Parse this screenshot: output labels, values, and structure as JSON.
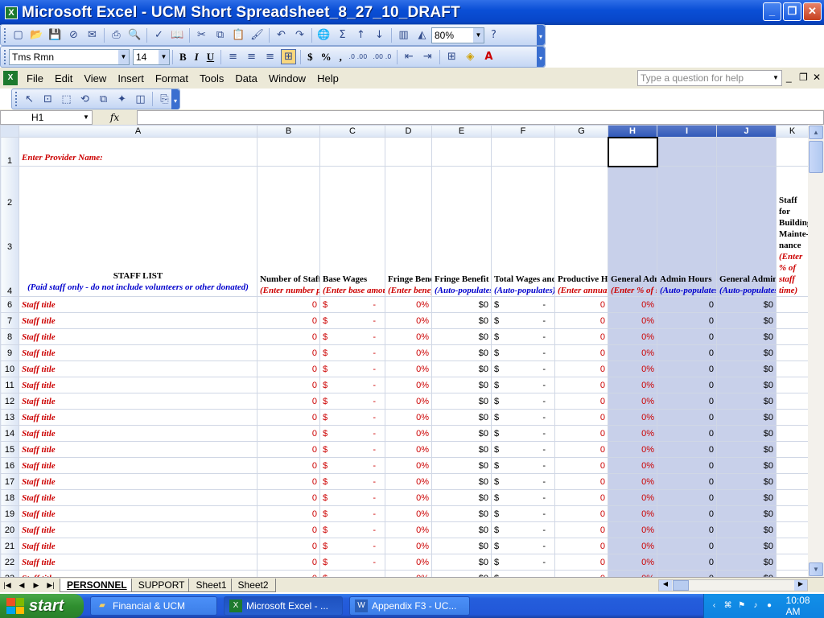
{
  "window": {
    "title": "Microsoft Excel - UCM Short Spreadsheet_8_27_10_DRAFT"
  },
  "toolbar": {
    "font_name": "Tms Rmn",
    "font_size": "14",
    "zoom": "80%",
    "bold": "B",
    "italic": "I",
    "underline": "U",
    "currency": "$",
    "percent": "%",
    "comma": ",",
    "inc_decimal": ".0 .00",
    "dec_decimal": ".00 .0"
  },
  "menu": {
    "items": [
      "File",
      "Edit",
      "View",
      "Insert",
      "Format",
      "Tools",
      "Data",
      "Window",
      "Help"
    ],
    "help_placeholder": "Type a question for help"
  },
  "formula_bar": {
    "name_box": "H1",
    "fx": "fx",
    "value": ""
  },
  "columns": [
    "A",
    "B",
    "C",
    "D",
    "E",
    "F",
    "G",
    "H",
    "I",
    "J",
    "K"
  ],
  "sheet": {
    "row1": {
      "a": "Enter Provider Name:"
    },
    "header": {
      "a_title": "STAFF LIST",
      "a_note": "(Paid staff only - do not include volunteers or other donated)",
      "b_title": "Number of Staff Positions",
      "b_note": "(Enter number per staff title)",
      "c_title": "Base Wages",
      "c_note": "(Enter base amount with no benefits included)",
      "d_title": "Fringe Benefit Rate",
      "d_note": "(Enter benefit costs by % only)",
      "e_title": "Fringe Benefit Dollars",
      "e_note": "(Auto-populates)",
      "f_title": "Total Wages and Benefits",
      "f_note": "(Auto-populates)",
      "g_title": "Productive Hours",
      "g_note": "(Enter annual productive hours)",
      "h_title": "General Admin",
      "h_note": "(Enter % of staff time in admin)",
      "i_title": "Admin Hours",
      "i_note": "(Auto-populates)",
      "j_title": "General Admin Costs",
      "j_note": "(Auto-populates)",
      "k_title": "Staff for Building Mainte-nance",
      "k_note": "(Enter % of staff time)"
    },
    "row_labels": [
      "1",
      "2",
      "3",
      "4"
    ],
    "rows": [
      {
        "n": "6",
        "title": "Staff title",
        "b": "0",
        "c_sym": "$",
        "c": "-",
        "d": "0%",
        "e": "$0",
        "f_sym": "$",
        "f": "-",
        "g": "0",
        "h": "0%",
        "i": "0",
        "j": "$0"
      },
      {
        "n": "7",
        "title": "Staff title",
        "b": "0",
        "c_sym": "$",
        "c": "-",
        "d": "0%",
        "e": "$0",
        "f_sym": "$",
        "f": "-",
        "g": "0",
        "h": "0%",
        "i": "0",
        "j": "$0"
      },
      {
        "n": "8",
        "title": "Staff title",
        "b": "0",
        "c_sym": "$",
        "c": "-",
        "d": "0%",
        "e": "$0",
        "f_sym": "$",
        "f": "-",
        "g": "0",
        "h": "0%",
        "i": "0",
        "j": "$0"
      },
      {
        "n": "9",
        "title": "Staff title",
        "b": "0",
        "c_sym": "$",
        "c": "-",
        "d": "0%",
        "e": "$0",
        "f_sym": "$",
        "f": "-",
        "g": "0",
        "h": "0%",
        "i": "0",
        "j": "$0"
      },
      {
        "n": "10",
        "title": "Staff title",
        "b": "0",
        "c_sym": "$",
        "c": "-",
        "d": "0%",
        "e": "$0",
        "f_sym": "$",
        "f": "-",
        "g": "0",
        "h": "0%",
        "i": "0",
        "j": "$0"
      },
      {
        "n": "11",
        "title": "Staff title",
        "b": "0",
        "c_sym": "$",
        "c": "-",
        "d": "0%",
        "e": "$0",
        "f_sym": "$",
        "f": "-",
        "g": "0",
        "h": "0%",
        "i": "0",
        "j": "$0"
      },
      {
        "n": "12",
        "title": "Staff title",
        "b": "0",
        "c_sym": "$",
        "c": "-",
        "d": "0%",
        "e": "$0",
        "f_sym": "$",
        "f": "-",
        "g": "0",
        "h": "0%",
        "i": "0",
        "j": "$0"
      },
      {
        "n": "13",
        "title": "Staff title",
        "b": "0",
        "c_sym": "$",
        "c": "-",
        "d": "0%",
        "e": "$0",
        "f_sym": "$",
        "f": "-",
        "g": "0",
        "h": "0%",
        "i": "0",
        "j": "$0"
      },
      {
        "n": "14",
        "title": "Staff title",
        "b": "0",
        "c_sym": "$",
        "c": "-",
        "d": "0%",
        "e": "$0",
        "f_sym": "$",
        "f": "-",
        "g": "0",
        "h": "0%",
        "i": "0",
        "j": "$0"
      },
      {
        "n": "15",
        "title": "Staff title",
        "b": "0",
        "c_sym": "$",
        "c": "-",
        "d": "0%",
        "e": "$0",
        "f_sym": "$",
        "f": "-",
        "g": "0",
        "h": "0%",
        "i": "0",
        "j": "$0"
      },
      {
        "n": "16",
        "title": "Staff title",
        "b": "0",
        "c_sym": "$",
        "c": "-",
        "d": "0%",
        "e": "$0",
        "f_sym": "$",
        "f": "-",
        "g": "0",
        "h": "0%",
        "i": "0",
        "j": "$0"
      },
      {
        "n": "17",
        "title": "Staff title",
        "b": "0",
        "c_sym": "$",
        "c": "-",
        "d": "0%",
        "e": "$0",
        "f_sym": "$",
        "f": "-",
        "g": "0",
        "h": "0%",
        "i": "0",
        "j": "$0"
      },
      {
        "n": "18",
        "title": "Staff title",
        "b": "0",
        "c_sym": "$",
        "c": "-",
        "d": "0%",
        "e": "$0",
        "f_sym": "$",
        "f": "-",
        "g": "0",
        "h": "0%",
        "i": "0",
        "j": "$0"
      },
      {
        "n": "19",
        "title": "Staff title",
        "b": "0",
        "c_sym": "$",
        "c": "-",
        "d": "0%",
        "e": "$0",
        "f_sym": "$",
        "f": "-",
        "g": "0",
        "h": "0%",
        "i": "0",
        "j": "$0"
      },
      {
        "n": "20",
        "title": "Staff title",
        "b": "0",
        "c_sym": "$",
        "c": "-",
        "d": "0%",
        "e": "$0",
        "f_sym": "$",
        "f": "-",
        "g": "0",
        "h": "0%",
        "i": "0",
        "j": "$0"
      },
      {
        "n": "21",
        "title": "Staff title",
        "b": "0",
        "c_sym": "$",
        "c": "-",
        "d": "0%",
        "e": "$0",
        "f_sym": "$",
        "f": "-",
        "g": "0",
        "h": "0%",
        "i": "0",
        "j": "$0"
      },
      {
        "n": "22",
        "title": "Staff title",
        "b": "0",
        "c_sym": "$",
        "c": "-",
        "d": "0%",
        "e": "$0",
        "f_sym": "$",
        "f": "-",
        "g": "0",
        "h": "0%",
        "i": "0",
        "j": "$0"
      },
      {
        "n": "23",
        "title": "Staff title",
        "b": "0",
        "c_sym": "$",
        "c": "-",
        "d": "0%",
        "e": "$0",
        "f_sym": "$",
        "f": "-",
        "g": "0",
        "h": "0%",
        "i": "0",
        "j": "$0"
      }
    ]
  },
  "sheet_tabs": [
    "PERSONNEL",
    "SUPPORT",
    "Sheet1",
    "Sheet2"
  ],
  "taskbar": {
    "start": "start",
    "tasks": [
      "Financial & UCM",
      "Microsoft Excel - ...",
      "Appendix F3 - UC..."
    ],
    "clock": "10:08 AM"
  },
  "colors": {
    "title_blue": "#0a4fd6",
    "red_text": "#cc0000",
    "blue_text": "#0000cc",
    "selection": "#c8d0ea",
    "taskbar_blue": "#245edc",
    "start_green": "#2f8f2f"
  }
}
